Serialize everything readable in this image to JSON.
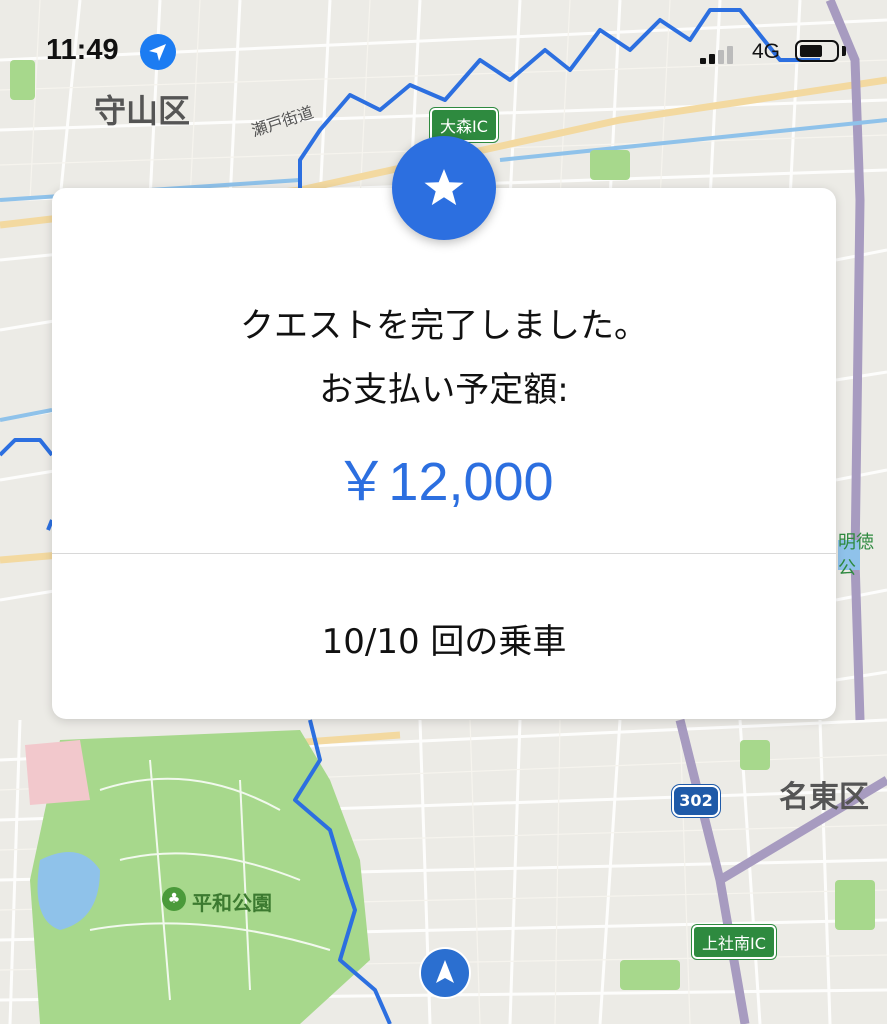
{
  "status_bar": {
    "time": "11:49",
    "network": "4G",
    "icons": [
      "location-arrow-icon",
      "signal-icon",
      "battery-icon"
    ]
  },
  "map": {
    "labels": {
      "moriyama": "守山区",
      "seto_kaido": "瀬戸街道",
      "meito": "名東区",
      "heiwa_park": "平和公園",
      "meitoku": "明徳公"
    },
    "badges": {
      "omori_ic": "大森IC",
      "kamiyashiro_ic": "上社南IC",
      "route_302": "302"
    },
    "colors": {
      "route": "#2c6fe0",
      "park": "#a7d88c",
      "water": "#8fc2ea",
      "highway": "#a79bc0"
    }
  },
  "quest_card": {
    "icon": "star-icon",
    "title": "クエストを完了しました。",
    "payout_label": "お支払い予定額:",
    "amount": "￥12,000",
    "rides": "10/10 回の乗車",
    "accent_color": "#2c6fe0"
  }
}
